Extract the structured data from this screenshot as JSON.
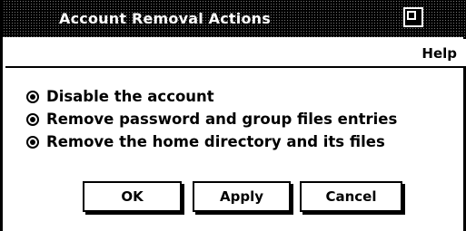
{
  "window": {
    "title": "Account Removal Actions",
    "icons": {
      "window_menu": "window-toggle-icon"
    }
  },
  "menubar": {
    "help_label": "Help"
  },
  "options": [
    {
      "label": "Disable the account",
      "selected": true
    },
    {
      "label": "Remove password and group files entries",
      "selected": true
    },
    {
      "label": "Remove the home directory and its files",
      "selected": true
    }
  ],
  "buttons": {
    "ok_label": "OK",
    "apply_label": "Apply",
    "cancel_label": "Cancel"
  },
  "colors": {
    "background": "#ffffff",
    "foreground": "#000000"
  }
}
